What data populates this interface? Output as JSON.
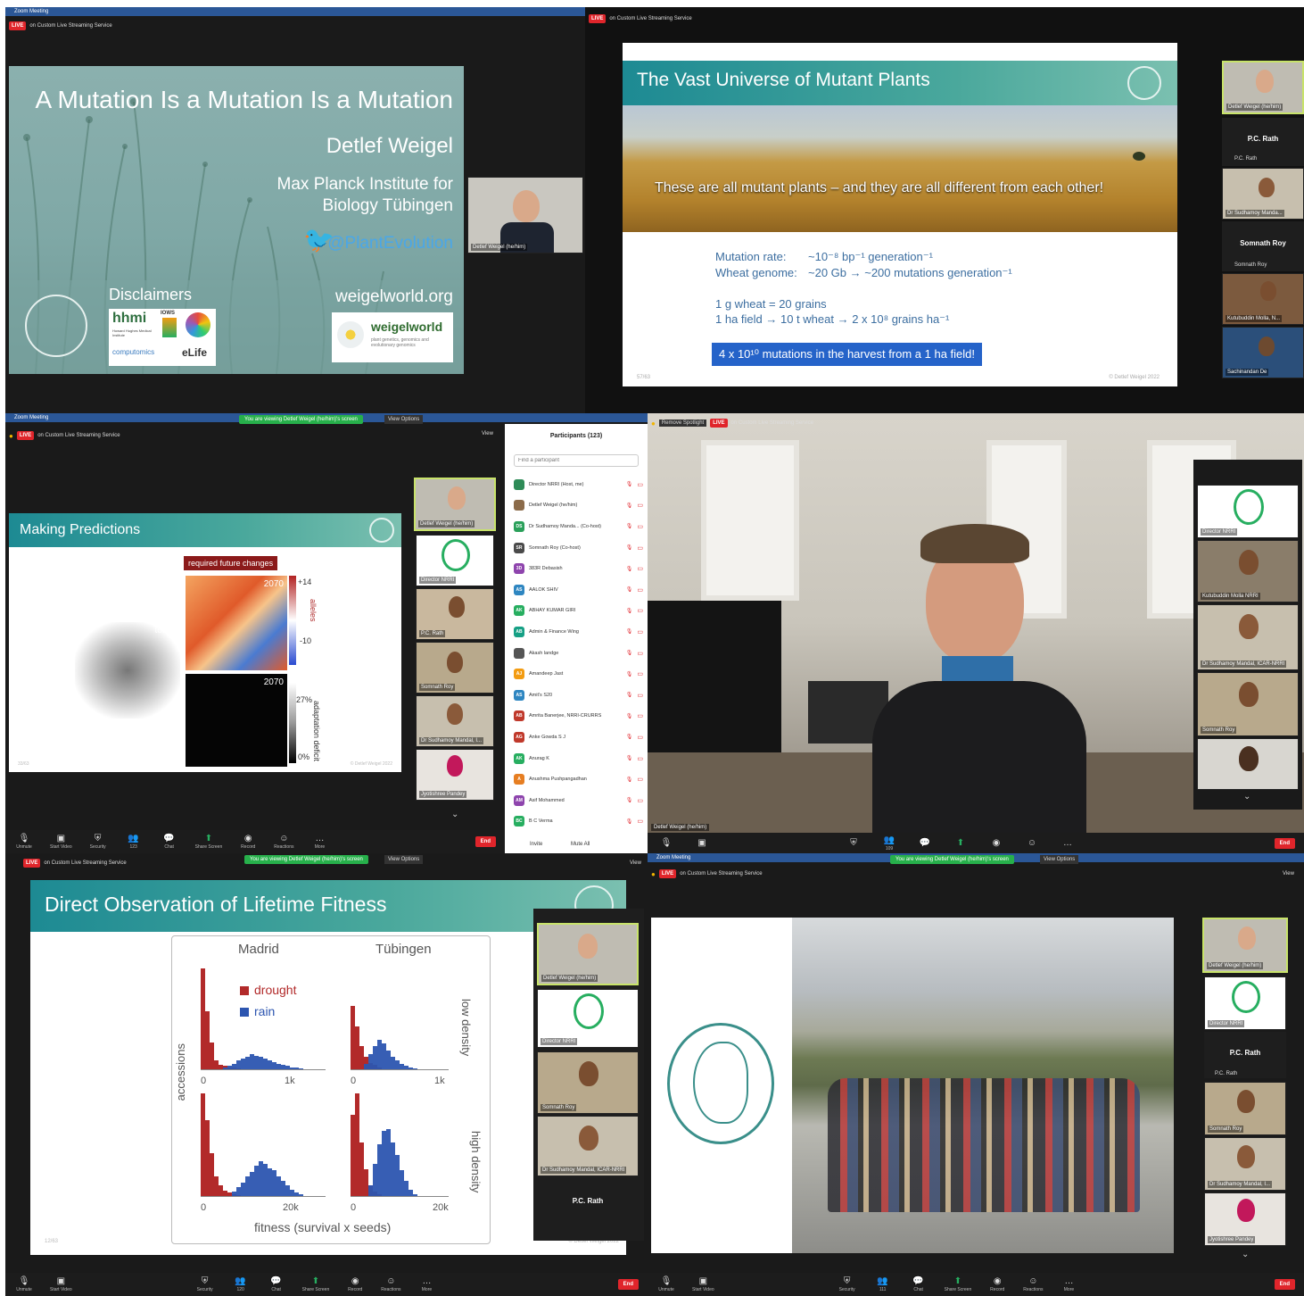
{
  "zoom": {
    "window_title": "Zoom Meeting",
    "live": "LIVE",
    "stream_service": "on Custom Live Streaming Service",
    "viewing_banner": "You are viewing Detlef Weigel (he/him)'s screen",
    "view_options": "View Options",
    "view_label": "View",
    "remove_spotlight": "Remove Spotlight",
    "end": "End"
  },
  "toolbar": {
    "unmute": "Unmute",
    "start_video": "Start Video",
    "security": "Security",
    "participants": "Participants",
    "participants_count_a": "123",
    "participants_count_b": "120",
    "participants_count_c": "111",
    "participants_count_d": "109",
    "chat": "Chat",
    "share_screen": "Share Screen",
    "record": "Record",
    "reactions": "Reactions",
    "more": "More"
  },
  "slide1": {
    "title": "A Mutation Is a Mutation Is a Mutation",
    "speaker": "Detlef Weigel",
    "inst1": "Max Planck Institute for",
    "inst2": "Biology Tübingen",
    "twitter": "@PlantEvolution",
    "disclaimers": "Disclaimers",
    "website": "weigelworld.org",
    "hhmi": "hhmi",
    "hhmi_sub": "Howard Hughes Medical Institute",
    "ioxs": "IOWS",
    "computomics": "computomics",
    "elife": "eLife",
    "weigelworld_logo": "weigelworld",
    "weigelworld_sub": "plant genetics, genomics and evolutionary genomics"
  },
  "slide2": {
    "title": "The Vast Universe of Mutant Plants",
    "banner": "These are all mutant plants – and they are all different from each other!",
    "line1_label": "Mutation rate:",
    "line1_value": "~10⁻⁸ bp⁻¹ generation⁻¹",
    "line2_label": "Wheat genome:",
    "line2_value": "~20 Gb → ~200 mutations generation⁻¹",
    "line3": "1 g wheat = 20 grains",
    "line4": "1 ha field → 10 t wheat → 2 x 10⁸ grains ha⁻¹",
    "highlight": "4 x 10¹⁰ mutations in the harvest from a 1 ha field!",
    "slide_num": "57/63",
    "copyright": "© Detlef Weigel 2022"
  },
  "slide3": {
    "title": "Making Predictions",
    "required": "required future changes",
    "today": "today",
    "y2070": "2070",
    "y2070b": "2070",
    "plus14": "+14",
    "minus10": "-10",
    "alleles": "alleles",
    "pct27": "27%",
    "pct0": "0%",
    "adaptation": "adaptation deficit",
    "slide_num": "33/63",
    "copyright": "© Detlef Weigel 2022"
  },
  "slide4": {
    "title": "Direct Observation of Lifetime Fitness",
    "col1": "Madrid",
    "col2": "Tübingen",
    "drought": "drought",
    "rain": "rain",
    "low_density": "low density",
    "high_density": "high density",
    "ylabel": "accessions",
    "xlabel": "fitness (survival x seeds)",
    "tick_0a": "0",
    "tick_1k_a": "1k",
    "tick_0b": "0",
    "tick_1k_b": "1k",
    "tick_0c": "0",
    "tick_20k_a": "20k",
    "tick_0d": "0",
    "tick_20k_b": "20k",
    "slide_num": "12/63",
    "copyright": "© Detlef Weigel 2022"
  },
  "participants_panel": {
    "title": "Participants (123)",
    "search_placeholder": "Find a participant",
    "invite": "Invite",
    "mute_all": "Mute All",
    "list": [
      {
        "initials": "",
        "name": "Director NRRI (Host, me)",
        "color": "#2e8b57"
      },
      {
        "initials": "",
        "name": "Detlef Weigel (he/him)",
        "color": "#8b6b4a"
      },
      {
        "initials": "DS",
        "name": "Dr Sudhamoy Manda... (Co-host)",
        "color": "#2aa05a"
      },
      {
        "initials": "SR",
        "name": "Somnath Roy (Co-host)",
        "color": "#4a4a4a"
      },
      {
        "initials": "3D",
        "name": "383R Debasish",
        "color": "#8e44ad"
      },
      {
        "initials": "AS",
        "name": "AALOK SHIV",
        "color": "#2e86c1"
      },
      {
        "initials": "AK",
        "name": "ABHAY KUMAR GIRI",
        "color": "#27ae60"
      },
      {
        "initials": "AB",
        "name": "Admin & Finance Wing",
        "color": "#16a085"
      },
      {
        "initials": "",
        "name": "Akash landge",
        "color": "#555"
      },
      {
        "initials": "AJ",
        "name": "Amandeep Jast",
        "color": "#f39c12"
      },
      {
        "initials": "AS",
        "name": "Amit's S20",
        "color": "#2e86c1"
      },
      {
        "initials": "AB",
        "name": "Amrita Banerjee, NRRI-CRURRS",
        "color": "#c0392b"
      },
      {
        "initials": "AG",
        "name": "Anke Gowda S J",
        "color": "#c0392b"
      },
      {
        "initials": "AK",
        "name": "Anurag K",
        "color": "#27ae60"
      },
      {
        "initials": "A",
        "name": "Anushma Pushpangadhan",
        "color": "#e67e22"
      },
      {
        "initials": "AM",
        "name": "Asif Mohammed",
        "color": "#8e44ad"
      },
      {
        "initials": "BC",
        "name": "B C Verma",
        "color": "#27ae60"
      }
    ]
  },
  "people": {
    "detlef": "Detlef Weigel (he/him)",
    "pc_rath": "P.C. Rath",
    "pc_rath_small": "P.C. Rath",
    "sudhamoy": "Dr Sudhamoy Manda...",
    "sudhamoy_full": "Dr Sudhamoy Mandal, ICAR-NRRI",
    "sudhamoy_short": "Dr Sudhamoy Mandal, I...",
    "somnath_card": "Somnath Roy",
    "somnath": "Somnath Roy",
    "kutubuddin": "Kutubuddin Molla, N...",
    "kutubuddin_full": "Kutubuddin Molla NRRI",
    "sachinandan": "Sachinandan De",
    "director": "Director NRRI",
    "jyotishree": "Jyotishree Pandey"
  }
}
